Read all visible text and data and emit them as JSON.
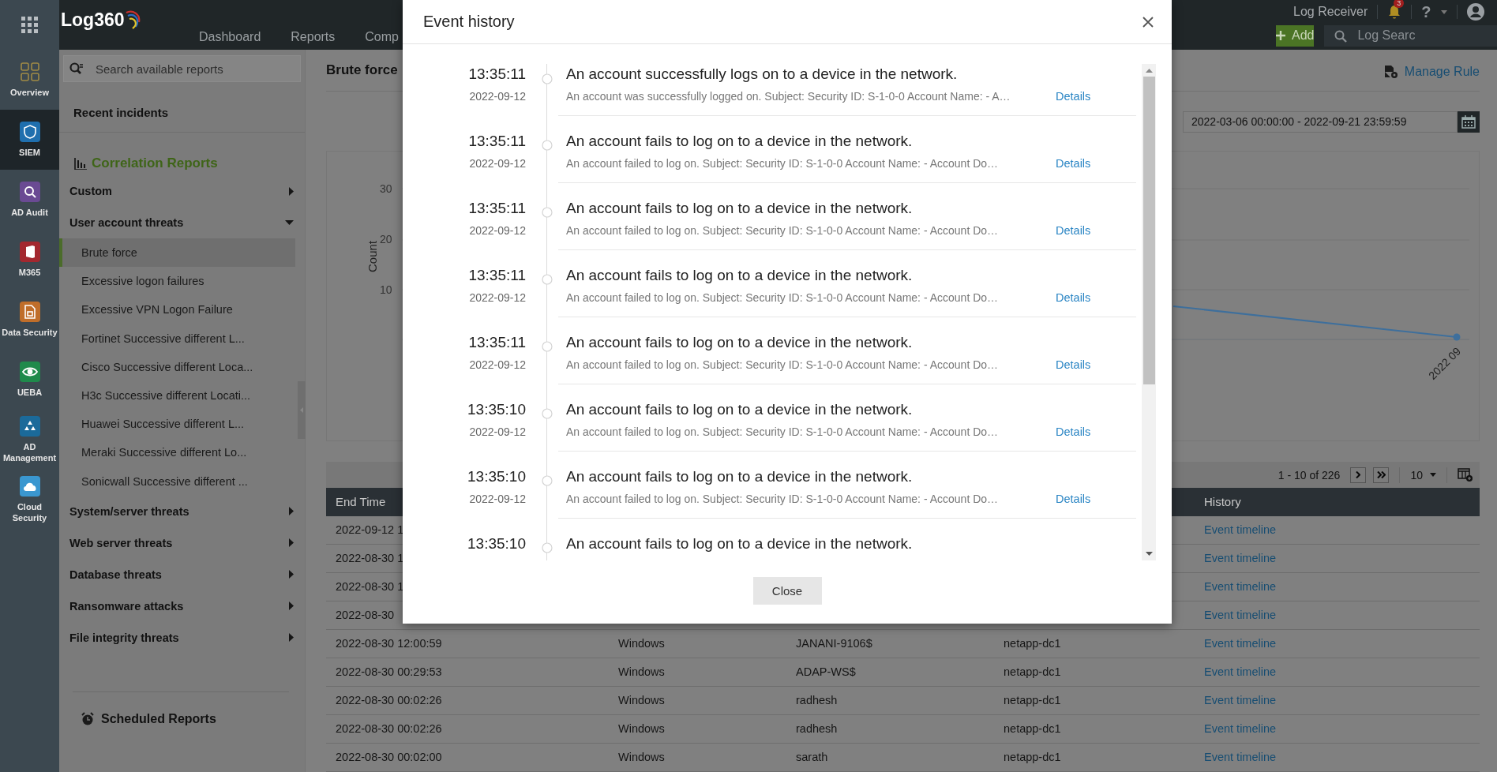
{
  "rail": {
    "items": [
      {
        "label": "Overview",
        "selected": false
      },
      {
        "label": "SIEM",
        "selected": true
      },
      {
        "label": "AD Audit",
        "selected": false
      },
      {
        "label": "M365",
        "selected": false
      },
      {
        "label": "Data Security",
        "selected": false
      },
      {
        "label": "UEBA",
        "selected": false
      },
      {
        "label": "AD Management",
        "selected": false
      },
      {
        "label": "Cloud Security",
        "selected": false
      }
    ]
  },
  "topbar": {
    "logo": "Log360",
    "nav": [
      "Dashboard",
      "Reports",
      "Comp"
    ],
    "log_receiver": "Log Receiver",
    "notification_count": "3",
    "help": "?",
    "add_button": "Add",
    "search": {
      "placeholder": "Log Searc"
    }
  },
  "sidebar": {
    "search": {
      "placeholder": "Search available reports"
    },
    "recent": "Recent incidents",
    "section_title": "Correlation Reports",
    "groups": [
      {
        "label": "Custom",
        "expanded": false
      },
      {
        "label": "User account threats",
        "expanded": true,
        "children": [
          {
            "label": "Brute force",
            "selected": true
          },
          {
            "label": "Excessive logon failures",
            "selected": false
          },
          {
            "label": "Excessive VPN Logon Failure",
            "selected": false
          },
          {
            "label": "Fortinet Successive different L...",
            "selected": false
          },
          {
            "label": "Cisco Successive different Loca...",
            "selected": false
          },
          {
            "label": "H3c Successive different Locati...",
            "selected": false
          },
          {
            "label": "Huawei Successive different L...",
            "selected": false
          },
          {
            "label": "Meraki Successive different Lo...",
            "selected": false
          },
          {
            "label": "Sonicwall Successive different ...",
            "selected": false
          }
        ]
      },
      {
        "label": "System/server threats",
        "expanded": false
      },
      {
        "label": "Web server threats",
        "expanded": false
      },
      {
        "label": "Database threats",
        "expanded": false
      },
      {
        "label": "Ransomware attacks",
        "expanded": false
      },
      {
        "label": "File integrity threats",
        "expanded": false
      }
    ],
    "scheduled": "Scheduled Reports"
  },
  "main": {
    "title": "Brute force",
    "manage_rule": "Manage Rule",
    "date_range": "2022-03-06 00:00:00 - 2022-09-21 23:59:59",
    "chart": {
      "ylabel": "Count",
      "ytick_labels": [
        "30",
        "20",
        "10"
      ],
      "xtick_labels": [
        "2022 09"
      ]
    },
    "pagination": {
      "range": "1 - 10 of 226",
      "page_size": "10"
    },
    "table": {
      "header": {
        "end_time": "End Time",
        "history": "History"
      },
      "rows": [
        {
          "end_time": "2022-09-12 1",
          "history": "Event timeline"
        },
        {
          "end_time": "2022-08-30 1",
          "history": "Event timeline"
        },
        {
          "end_time": "2022-08-30 1",
          "history": "Event timeline"
        },
        {
          "end_time": "2022-08-30",
          "history": "Event timeline"
        },
        {
          "end_time": "2022-08-30 12:00:59",
          "os": "Windows",
          "user": "JANANI-9106$",
          "host": "netapp-dc1",
          "history": "Event timeline"
        },
        {
          "end_time": "2022-08-30 00:29:53",
          "os": "Windows",
          "user": "ADAP-WS$",
          "host": "netapp-dc1",
          "history": "Event timeline"
        },
        {
          "end_time": "2022-08-30 00:02:26",
          "os": "Windows",
          "user": "radhesh",
          "host": "netapp-dc1",
          "history": "Event timeline"
        },
        {
          "end_time": "2022-08-30 00:02:26",
          "os": "Windows",
          "user": "radhesh",
          "host": "netapp-dc1",
          "history": "Event timeline"
        },
        {
          "end_time": "2022-08-30 00:02:00",
          "os": "Windows",
          "user": "sarath",
          "host": "netapp-dc1",
          "history": "Event timeline"
        }
      ]
    }
  },
  "modal": {
    "title": "Event history",
    "close_button": "Close",
    "events": [
      {
        "time": "13:35:11",
        "date": "2022-09-12",
        "title": "An account successfully logs on to a device in the network.",
        "description": "An account was successfully logged on. Subject: Security ID: S-1-0-0 Account Name: - A…",
        "link": "Details"
      },
      {
        "time": "13:35:11",
        "date": "2022-09-12",
        "title": "An account fails to log on to a device in the network.",
        "description": "An account failed to log on. Subject: Security ID: S-1-0-0 Account Name: - Account Do…",
        "link": "Details"
      },
      {
        "time": "13:35:11",
        "date": "2022-09-12",
        "title": "An account fails to log on to a device in the network.",
        "description": "An account failed to log on. Subject: Security ID: S-1-0-0 Account Name: - Account Do…",
        "link": "Details"
      },
      {
        "time": "13:35:11",
        "date": "2022-09-12",
        "title": "An account fails to log on to a device in the network.",
        "description": "An account failed to log on. Subject: Security ID: S-1-0-0 Account Name: - Account Do…",
        "link": "Details"
      },
      {
        "time": "13:35:11",
        "date": "2022-09-12",
        "title": "An account fails to log on to a device in the network.",
        "description": "An account failed to log on. Subject: Security ID: S-1-0-0 Account Name: - Account Do…",
        "link": "Details"
      },
      {
        "time": "13:35:10",
        "date": "2022-09-12",
        "title": "An account fails to log on to a device in the network.",
        "description": "An account failed to log on. Subject: Security ID: S-1-0-0 Account Name: - Account Do…",
        "link": "Details"
      },
      {
        "time": "13:35:10",
        "date": "2022-09-12",
        "title": "An account fails to log on to a device in the network.",
        "description": "An account failed to log on. Subject: Security ID: S-1-0-0 Account Name: - Account Do…",
        "link": "Details"
      },
      {
        "time": "13:35:10",
        "title": "An account fails to log on to a device in the network."
      }
    ]
  }
}
